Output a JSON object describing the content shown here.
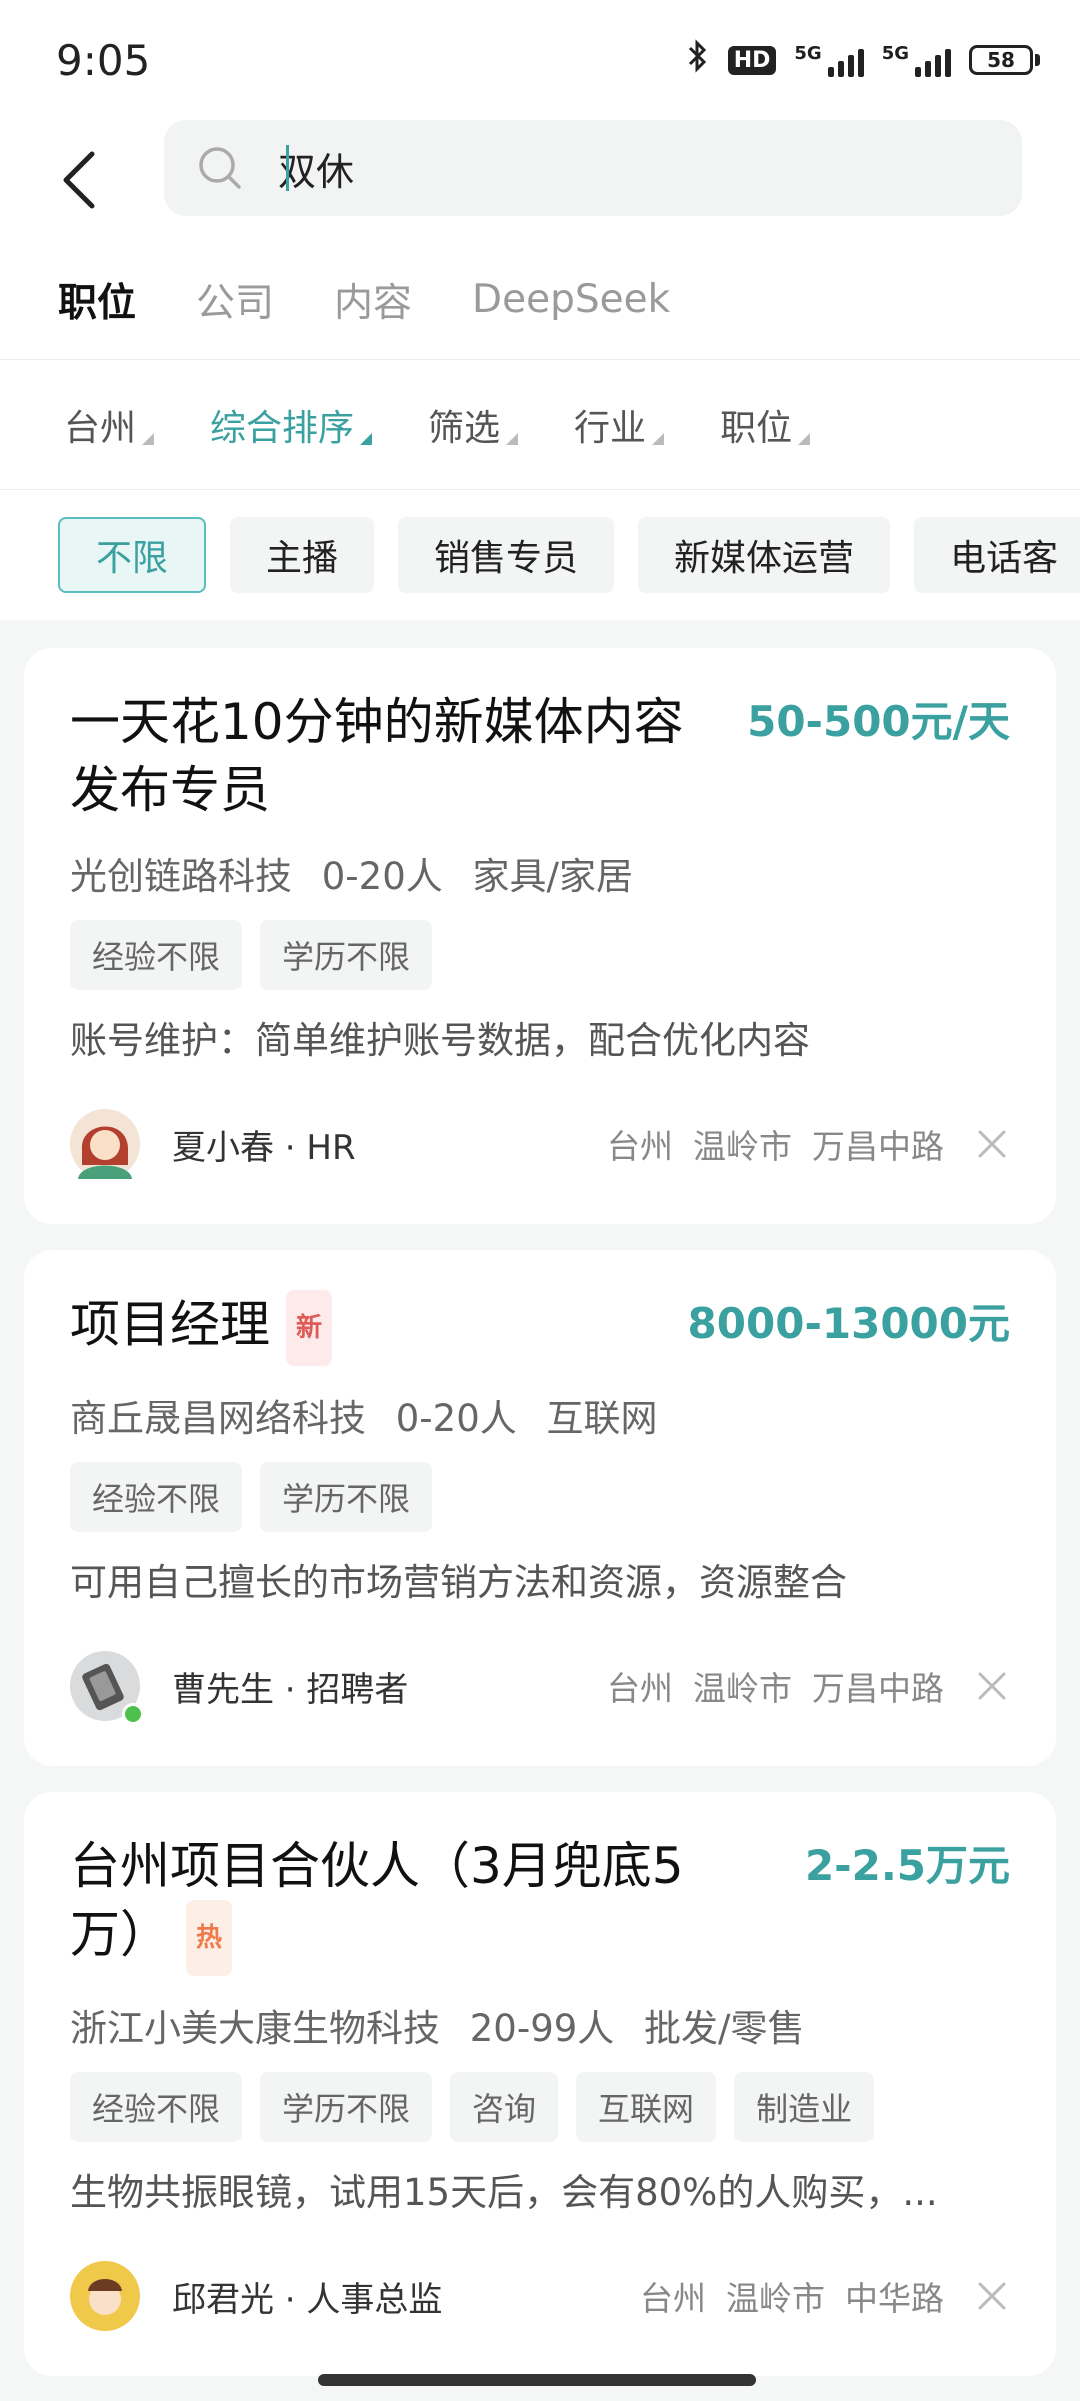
{
  "status": {
    "time": "9:05",
    "battery": "58",
    "network_1": "5G",
    "network_2": "5G",
    "hd_label": "HD"
  },
  "search": {
    "value": "双休"
  },
  "tabs": [
    "职位",
    "公司",
    "内容",
    "DeepSeek"
  ],
  "filters": [
    "台州",
    "综合排序",
    "筛选",
    "行业",
    "职位"
  ],
  "chips": [
    "不限",
    "主播",
    "销售专员",
    "新媒体运营",
    "电话客"
  ],
  "jobs": [
    {
      "title": "一天花10分钟的新媒体内容发布专员",
      "badge": "",
      "salary": "50-500元/天",
      "company": "光创链路科技",
      "size": "0-20人",
      "industry": "家具/家居",
      "tags": [
        "经验不限",
        "学历不限"
      ],
      "desc": "账号维护：简单维护账号数据，配合优化内容",
      "recruiter": "夏小春 · HR",
      "loc": [
        "台州",
        "温岭市",
        "万昌中路"
      ]
    },
    {
      "title": "项目经理",
      "badge": "新",
      "salary": "8000-13000元",
      "company": "商丘晟昌网络科技",
      "size": "0-20人",
      "industry": "互联网",
      "tags": [
        "经验不限",
        "学历不限"
      ],
      "desc": "可用自己擅长的市场营销方法和资源，资源整合",
      "recruiter": "曹先生 · 招聘者",
      "loc": [
        "台州",
        "温岭市",
        "万昌中路"
      ]
    },
    {
      "title": "台州项目合伙人（3月兜底5万）",
      "badge": "热",
      "salary": "2-2.5万元",
      "company": "浙江小美大康生物科技",
      "size": "20-99人",
      "industry": "批发/零售",
      "tags": [
        "经验不限",
        "学历不限",
        "咨询",
        "互联网",
        "制造业"
      ],
      "desc": "生物共振眼镜，试用15天后，会有80%的人购买，...",
      "recruiter": "邱君光 · 人事总监",
      "loc": [
        "台州",
        "温岭市",
        "中华路"
      ]
    }
  ],
  "colors": {
    "accent": "#3aa0a0",
    "new_badge": "#e05a5a",
    "hot_badge": "#f07a4a"
  }
}
